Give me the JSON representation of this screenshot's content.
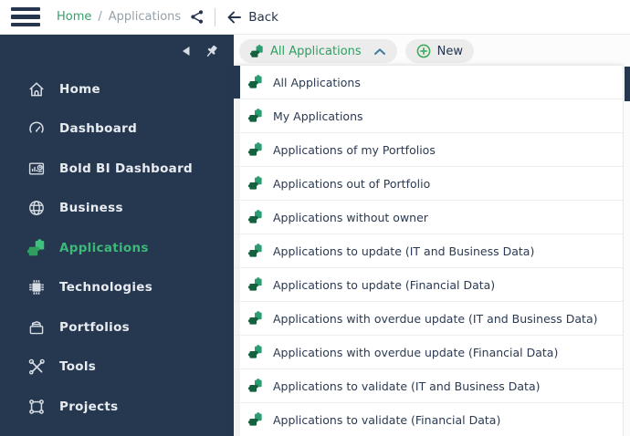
{
  "topbar": {
    "breadcrumb": {
      "home": "Home",
      "separator": "/",
      "current": "Applications"
    },
    "back_label": "Back"
  },
  "sidebar": {
    "items": [
      {
        "label": "Home",
        "icon": "home-icon",
        "active": false
      },
      {
        "label": "Dashboard",
        "icon": "gauge-icon",
        "active": false
      },
      {
        "label": "Bold BI Dashboard",
        "icon": "bi-chart-icon",
        "active": false
      },
      {
        "label": "Business",
        "icon": "globe-icon",
        "active": false
      },
      {
        "label": "Applications",
        "icon": "puzzle-icon",
        "active": true
      },
      {
        "label": "Technologies",
        "icon": "chip-icon",
        "active": false
      },
      {
        "label": "Portfolios",
        "icon": "portfolio-icon",
        "active": false
      },
      {
        "label": "Tools",
        "icon": "tools-icon",
        "active": false
      },
      {
        "label": "Projects",
        "icon": "projects-icon",
        "active": false
      }
    ]
  },
  "toolbar": {
    "view_selector": {
      "label": "All Applications",
      "state": "expanded"
    },
    "new_button": {
      "label": "New"
    }
  },
  "view_dropdown": {
    "items": [
      {
        "label": "All Applications",
        "selected": true
      },
      {
        "label": "My Applications",
        "selected": false
      },
      {
        "label": "Applications of my Portfolios",
        "selected": false
      },
      {
        "label": "Applications out of Portfolio",
        "selected": false
      },
      {
        "label": "Applications without owner",
        "selected": false
      },
      {
        "label": "Applications to update (IT and Business Data)",
        "selected": false
      },
      {
        "label": "Applications to update (Financial Data)",
        "selected": false
      },
      {
        "label": "Applications with overdue update (IT and Business Data)",
        "selected": false
      },
      {
        "label": "Applications with overdue update (Financial Data)",
        "selected": false
      },
      {
        "label": "Applications to validate (IT and Business Data)",
        "selected": false
      },
      {
        "label": "Applications to validate (Financial Data)",
        "selected": false
      }
    ]
  },
  "colors": {
    "sidebar_bg": "#263850",
    "accent_green": "#3cb878",
    "dark_navy": "#24354d",
    "pill_bg": "#ececec",
    "selector_text_green": "#2f9e61",
    "chevron_teal": "#44809e",
    "list_icon_dark_green": "#14603f",
    "list_icon_teal_green": "#2b9d72",
    "breadcrumb_gray": "#96a0a9"
  }
}
